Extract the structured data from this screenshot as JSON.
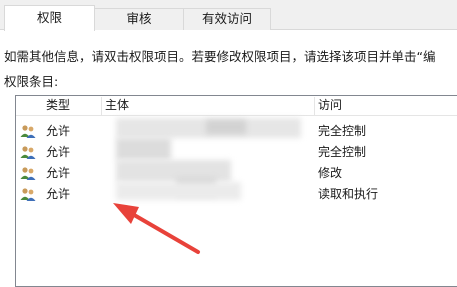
{
  "tabs": [
    {
      "label": "权限",
      "active": true
    },
    {
      "label": "审核",
      "active": false
    },
    {
      "label": "有效访问",
      "active": false
    }
  ],
  "info_text": "如需其他信息，请双击权限项目。若要修改权限项目，请选择该项目并单击“编",
  "entries_label": "权限条目:",
  "columns": {
    "type": "类型",
    "principal": "主体",
    "access": "访问"
  },
  "rows": [
    {
      "type": "允许",
      "principal": "",
      "access": "完全控制"
    },
    {
      "type": "允许",
      "principal": "",
      "access": "完全控制"
    },
    {
      "type": "允许",
      "principal": "",
      "access": "修改"
    },
    {
      "type": "允许",
      "principal": "",
      "access": "读取和执行"
    }
  ],
  "colors": {
    "arrow": "#e8423a",
    "list_border": "#828790"
  },
  "icons": {
    "row_icon": "user-group-icon"
  }
}
